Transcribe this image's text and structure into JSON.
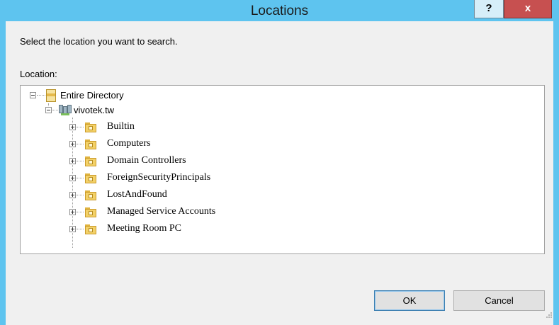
{
  "window": {
    "title": "Locations",
    "help_label": "?",
    "close_label": "x"
  },
  "dialog": {
    "prompt": "Select the location you want to search.",
    "location_label": "Location:"
  },
  "tree": {
    "root": {
      "label": "Entire Directory",
      "icon": "directory-icon",
      "expanded": true
    },
    "domain": {
      "label": "vivotek.tw",
      "icon": "domain-icon",
      "expanded": true
    },
    "children": [
      {
        "label": "Builtin",
        "icon": "folder-icon",
        "expanded": false
      },
      {
        "label": "Computers",
        "icon": "folder-icon",
        "expanded": false
      },
      {
        "label": "Domain Controllers",
        "icon": "folder-icon",
        "expanded": false
      },
      {
        "label": "ForeignSecurityPrincipals",
        "icon": "folder-icon",
        "expanded": false
      },
      {
        "label": "LostAndFound",
        "icon": "folder-icon",
        "expanded": false
      },
      {
        "label": "Managed Service Accounts",
        "icon": "folder-icon",
        "expanded": false
      },
      {
        "label": "Meeting Room PC",
        "icon": "folder-icon",
        "expanded": false
      }
    ]
  },
  "buttons": {
    "ok": "OK",
    "cancel": "Cancel"
  },
  "colors": {
    "titlebar": "#5ec4ef",
    "close": "#c75050",
    "dialog_bg": "#f0f0f0"
  }
}
